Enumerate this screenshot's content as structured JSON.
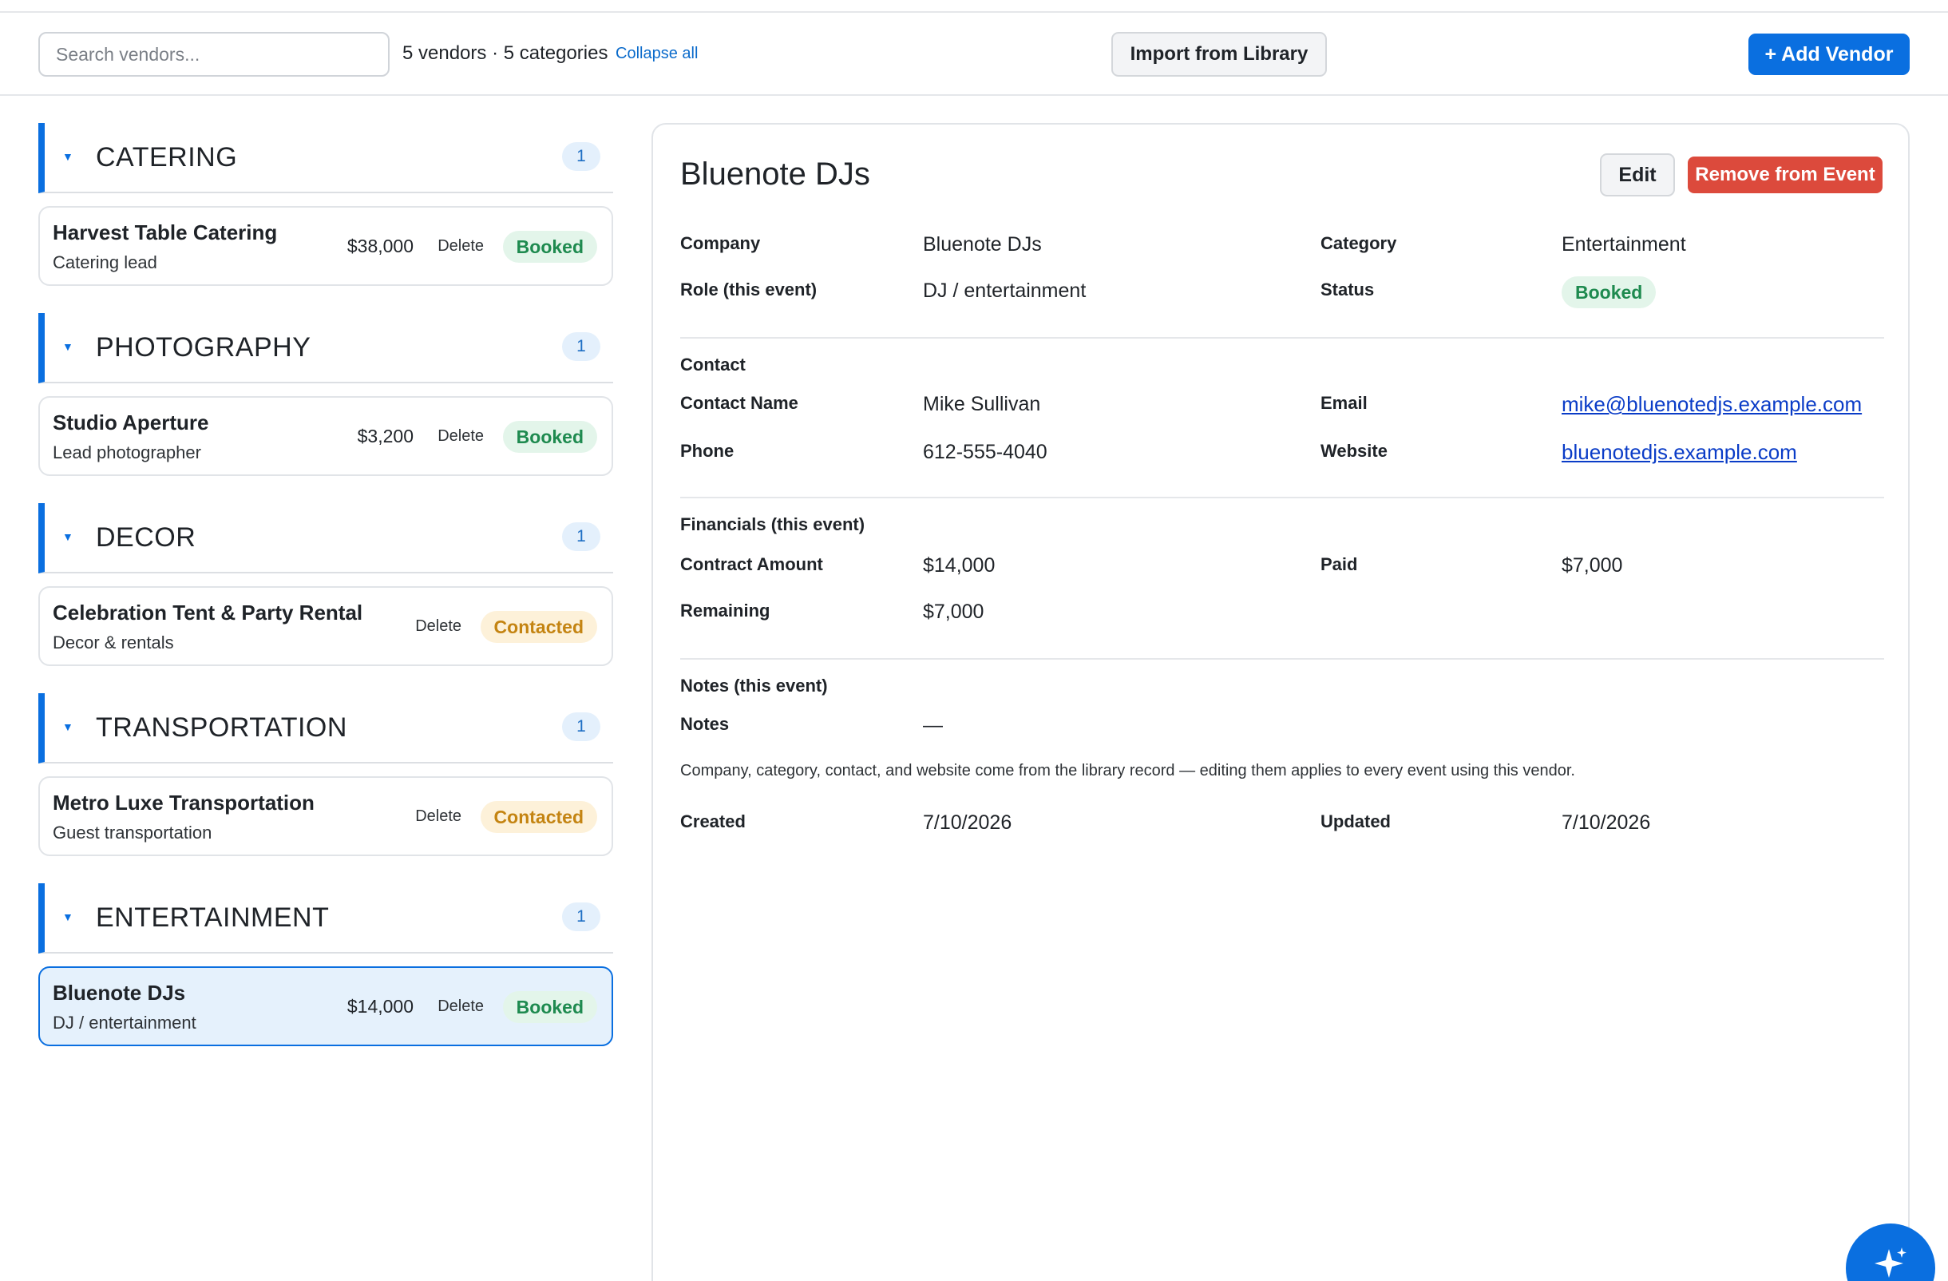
{
  "toolbar": {
    "search_placeholder": "Search vendors...",
    "summary": "5 vendors · 5 categories",
    "collapse_label": "Collapse all",
    "import_label": "Import from Library",
    "add_label": "+ Add Vendor"
  },
  "groups": [
    {
      "name": "CATERING",
      "count": "1",
      "vendor": {
        "name": "Harvest Table Catering",
        "role": "Catering lead",
        "amount": "$38,000",
        "delete": "Delete",
        "status": "Booked"
      }
    },
    {
      "name": "PHOTOGRAPHY",
      "count": "1",
      "vendor": {
        "name": "Studio Aperture",
        "role": "Lead photographer",
        "amount": "$3,200",
        "delete": "Delete",
        "status": "Booked"
      }
    },
    {
      "name": "DECOR",
      "count": "1",
      "vendor": {
        "name": "Celebration Tent & Party Rental",
        "role": "Decor & rentals",
        "amount": "",
        "delete": "Delete",
        "status": "Contacted"
      }
    },
    {
      "name": "TRANSPORTATION",
      "count": "1",
      "vendor": {
        "name": "Metro Luxe Transportation",
        "role": "Guest transportation",
        "amount": "",
        "delete": "Delete",
        "status": "Contacted"
      }
    },
    {
      "name": "ENTERTAINMENT",
      "count": "1",
      "vendor": {
        "name": "Bluenote DJs",
        "role": "DJ / entertainment",
        "amount": "$14,000",
        "delete": "Delete",
        "status": "Booked"
      }
    }
  ],
  "detail": {
    "title": "Bluenote DJs",
    "edit_label": "Edit",
    "remove_label": "Remove from Event",
    "company_label": "Company",
    "company": "Bluenote DJs",
    "category_label": "Category",
    "category": "Entertainment",
    "role_label": "Role (this event)",
    "role": "DJ / entertainment",
    "status_label": "Status",
    "status": "Booked",
    "contact_section": "Contact",
    "contact_name_label": "Contact Name",
    "contact_name": "Mike Sullivan",
    "email_label": "Email",
    "email": "mike@bluenotedjs.example.com",
    "phone_label": "Phone",
    "phone": "612-555-4040",
    "website_label": "Website",
    "website": "bluenotedjs.example.com",
    "financials_section": "Financials (this event)",
    "contract_label": "Contract Amount",
    "contract": "$14,000",
    "paid_label": "Paid",
    "paid": "$7,000",
    "remaining_label": "Remaining",
    "remaining": "$7,000",
    "notes_section": "Notes (this event)",
    "notes_label": "Notes",
    "notes": "—",
    "library_note": "Company, category, contact, and website come from the library record — editing them applies to every event using this vendor.",
    "created_label": "Created",
    "created": "7/10/2026",
    "updated_label": "Updated",
    "updated": "7/10/2026"
  },
  "colors": {
    "accent": "#0a6fe0",
    "danger": "#dc4a3c",
    "booked": "#1e8a4f",
    "contacted": "#c48412"
  },
  "icons": {
    "fab": "sparkle-icon",
    "caret": "caret-down-icon"
  }
}
